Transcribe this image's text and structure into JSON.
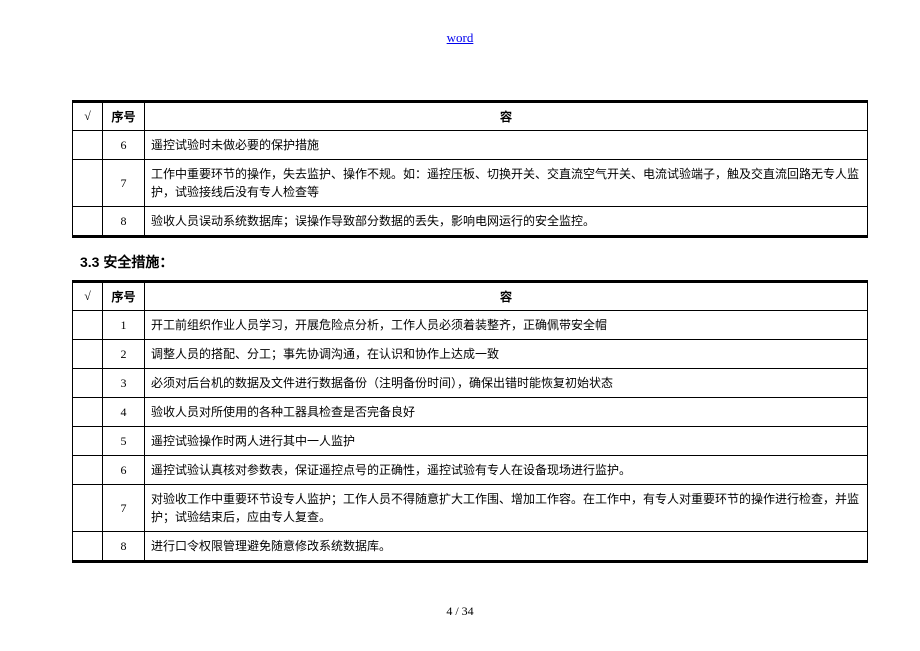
{
  "header_link": "word",
  "table1": {
    "check_header": "√",
    "num_header": "序号",
    "content_header": "容",
    "rows": [
      {
        "num": "6",
        "content": "遥控试验时未做必要的保护措施"
      },
      {
        "num": "7",
        "content": "工作中重要环节的操作，失去监护、操作不规。如：遥控压板、切换开关、交直流空气开关、电流试验端子，触及交直流回路无专人监护，试验接线后没有专人检查等"
      },
      {
        "num": "8",
        "content": "验收人员误动系统数据库；误操作导致部分数据的丢失，影响电网运行的安全监控。"
      }
    ]
  },
  "section_title": "3.3 安全措施：",
  "table2": {
    "check_header": "√",
    "num_header": "序号",
    "content_header": "容",
    "rows": [
      {
        "num": "1",
        "content": "开工前组织作业人员学习，开展危险点分析，工作人员必须着装整齐，正确佩带安全帽"
      },
      {
        "num": "2",
        "content": "调整人员的搭配、分工；事先协调沟通，在认识和协作上达成一致"
      },
      {
        "num": "3",
        "content": "必须对后台机的数据及文件进行数据备份（注明备份时间），确保出错时能恢复初始状态"
      },
      {
        "num": "4",
        "content": "验收人员对所使用的各种工器具检查是否完备良好"
      },
      {
        "num": "5",
        "content": "遥控试验操作时两人进行其中一人监护"
      },
      {
        "num": "6",
        "content": "遥控试验认真核对参数表，保证遥控点号的正确性，遥控试验有专人在设备现场进行监护。"
      },
      {
        "num": "7",
        "content": "对验收工作中重要环节设专人监护；工作人员不得随意扩大工作围、增加工作容。在工作中，有专人对重要环节的操作进行检查，并监护；试验结束后，应由专人复查。"
      },
      {
        "num": "8",
        "content": "进行口令权限管理避免随意修改系统数据库。"
      }
    ]
  },
  "footer": "4 / 34"
}
